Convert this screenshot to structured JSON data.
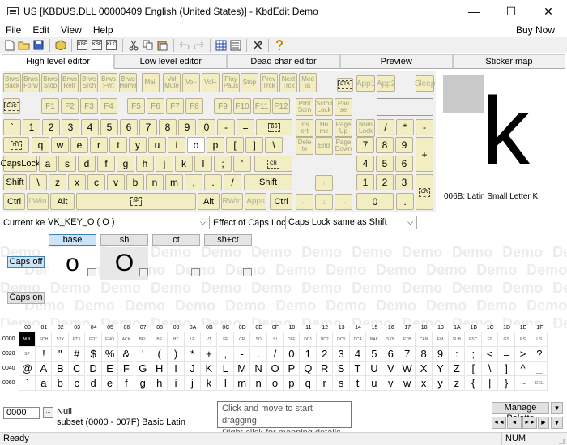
{
  "window": {
    "title": "US [KBDUS.DLL 00000409 English (United States)] - KbdEdit Demo",
    "minimize": "—",
    "maximize": "☐",
    "close": "✕"
  },
  "menu": {
    "items": [
      "File",
      "Edit",
      "View",
      "Help"
    ],
    "buy": "Buy Now"
  },
  "toolbar": {
    "labels": [
      "KBE",
      "KBE",
      "KLC"
    ]
  },
  "tabs": [
    "High level editor",
    "Low level editor",
    "Dead char editor",
    "Preview",
    "Sticker map"
  ],
  "keyboard": {
    "media_keys": [
      "Brws Back",
      "Brws Forw",
      "Brws Stop",
      "Brws Refr",
      "Brws Srch",
      "Brws Fvrt",
      "Brws Home",
      "Mail",
      "Vol Mute",
      "Vol-",
      "Vol+",
      "Play Paus",
      "Stop",
      "Prev Trck",
      "Next Trck",
      "Med ia"
    ],
    "etx": "ETX",
    "app_keys": [
      "App1",
      "App2",
      "Sleep"
    ],
    "esc": "ESC",
    "fkeys": [
      "F1",
      "F2",
      "F3",
      "F4",
      "F5",
      "F6",
      "F7",
      "F8",
      "F9",
      "F10",
      "F11",
      "F12"
    ],
    "sys_keys": [
      "Prnt Scrn",
      "Scroll Lock",
      "Pau se"
    ],
    "row1": [
      "`",
      "1",
      "2",
      "3",
      "4",
      "5",
      "6",
      "7",
      "8",
      "9",
      "0",
      "-",
      "="
    ],
    "bs": "BS",
    "ht": "HT",
    "row2": [
      "q",
      "w",
      "e",
      "r",
      "t",
      "y",
      "u",
      "i",
      "o",
      "p",
      "[",
      "]",
      "\\"
    ],
    "capslock": "CapsLock",
    "row3": [
      "a",
      "s",
      "d",
      "f",
      "g",
      "h",
      "j",
      "k",
      "l",
      ";",
      "'"
    ],
    "cr": "CR",
    "shift": "Shift",
    "row4": [
      "\\",
      "z",
      "x",
      "c",
      "v",
      "b",
      "n",
      "m",
      ",",
      ".",
      "/"
    ],
    "ctrl": "Ctrl",
    "lwin": "LWin",
    "alt": "Alt",
    "sp": "SP",
    "rwin": "RWin",
    "apps": "Apps",
    "nav1": [
      "Ins ert",
      "Ho me",
      "Page Up"
    ],
    "nav2": [
      "Dele te",
      "End",
      "Page Down"
    ],
    "arrows": [
      "↑",
      "←",
      "↓",
      "→"
    ],
    "numpad": {
      "numlock": "Num Lock",
      "row1": [
        "/",
        "*",
        "-"
      ],
      "row2": [
        "7",
        "8",
        "9"
      ],
      "plus": "+",
      "row3": [
        "4",
        "5",
        "6"
      ],
      "row4": [
        "1",
        "2",
        "3"
      ],
      "zero": "0",
      "dot": ".",
      "cr": "CR"
    }
  },
  "preview": {
    "glyph": "k",
    "label": "006B: Latin Small Letter K"
  },
  "current_key": {
    "label": "Current key",
    "value": "VK_KEY_O ( O )",
    "caps_label": "Effect of Caps Lock",
    "caps_value": "Caps Lock same as Shift"
  },
  "shift_states": {
    "headers": [
      "base",
      "sh",
      "ct",
      "sh+ct"
    ],
    "base_char": "o",
    "sh_char": "O",
    "mini": "..."
  },
  "caps_off": "Caps off",
  "caps_on": "Caps on",
  "watermark": "Demo",
  "grid": {
    "col_headers": [
      "00",
      "01",
      "02",
      "03",
      "04",
      "05",
      "06",
      "07",
      "08",
      "09",
      "0A",
      "0B",
      "0C",
      "0D",
      "0E",
      "0F",
      "10",
      "11",
      "12",
      "13",
      "14",
      "15",
      "16",
      "17",
      "18",
      "19",
      "1A",
      "1B",
      "1C",
      "1D",
      "1E",
      "1F"
    ],
    "row_headers": [
      "0000",
      "0020",
      "0040",
      "0060"
    ],
    "row0": [
      "NUL",
      "SOH",
      "STX",
      "ETX",
      "EOT",
      "ENQ",
      "ACK",
      "BEL",
      "BS",
      "HT",
      "LF",
      "VT",
      "FF",
      "CR",
      "SO",
      "SI",
      "DLE",
      "DC1",
      "DC2",
      "DC3",
      "DC4",
      "NAK",
      "SYN",
      "ETB",
      "CAN",
      "EM",
      "SUB",
      "ESC",
      "FS",
      "GS",
      "RS",
      "US"
    ],
    "row1": [
      "SP",
      "!",
      "\"",
      "#",
      "$",
      "%",
      "&",
      "'",
      "(",
      ")",
      "*",
      "+",
      ",",
      "-",
      ".",
      "/",
      "0",
      "1",
      "2",
      "3",
      "4",
      "5",
      "6",
      "7",
      "8",
      "9",
      ":",
      ";",
      "<",
      "=",
      ">",
      "?"
    ],
    "row2": [
      "@",
      "A",
      "B",
      "C",
      "D",
      "E",
      "F",
      "G",
      "H",
      "I",
      "J",
      "K",
      "L",
      "M",
      "N",
      "O",
      "P",
      "Q",
      "R",
      "S",
      "T",
      "U",
      "V",
      "W",
      "X",
      "Y",
      "Z",
      "[",
      "\\",
      "]",
      "^",
      "_"
    ],
    "row3": [
      "`",
      "a",
      "b",
      "c",
      "d",
      "e",
      "f",
      "g",
      "h",
      "i",
      "j",
      "k",
      "l",
      "m",
      "n",
      "o",
      "p",
      "q",
      "r",
      "s",
      "t",
      "u",
      "v",
      "w",
      "x",
      "y",
      "z",
      "{",
      "|",
      "}",
      "~",
      "DEL"
    ]
  },
  "code_field": "0000",
  "code_btn": "...",
  "code_name": "Null",
  "subset": "subset (0000 - 007F) Basic Latin",
  "tooltip": {
    "line1": "Click and move to start dragging",
    "line2": "Right-click for mapping details"
  },
  "manage_palette": "Manage Palette",
  "nav_buttons": [
    "◄",
    "▼",
    "◄◄",
    "►►",
    "▶"
  ],
  "status": {
    "ready": "Ready",
    "num": "NUM"
  }
}
